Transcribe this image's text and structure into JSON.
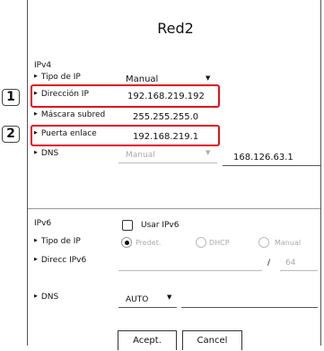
{
  "dialog": {
    "title": "Red2"
  },
  "ipv4": {
    "section_label": "IPv4",
    "ip_type": {
      "label": "Tipo de IP",
      "value": "Manual"
    },
    "ip_address": {
      "label": "Dirección IP",
      "value": "192.168.219.192"
    },
    "subnet_mask": {
      "label": "Máscara subred",
      "value": "255.255.255.0"
    },
    "gateway": {
      "label": "Puerta enlace",
      "value": "192.168.219.1"
    },
    "dns": {
      "label": "DNS",
      "mode": "Manual",
      "value": "168.126.63.1"
    }
  },
  "ipv6": {
    "section_label": "IPv6",
    "use_ipv6": {
      "label": "Usar IPv6",
      "checked": false
    },
    "ip_type": {
      "label": "Tipo de IP",
      "options": [
        "Predet.",
        "DHCP",
        "Manual"
      ],
      "selected": "Predet."
    },
    "address": {
      "label": "Direcc IPv6",
      "value": "",
      "slash": "/",
      "prefix": "64"
    },
    "dns": {
      "label": "DNS",
      "mode": "AUTO",
      "value": ""
    }
  },
  "callouts": [
    "1",
    "2"
  ],
  "buttons": {
    "ok": "Acept.",
    "cancel": "Cancel"
  },
  "colors": {
    "highlight": "#e0101c",
    "disabled_text": "#aaaaaa"
  },
  "icons": {
    "dropdown": "dropdown-caret-icon",
    "bullet": "bullet-triangle-icon"
  }
}
